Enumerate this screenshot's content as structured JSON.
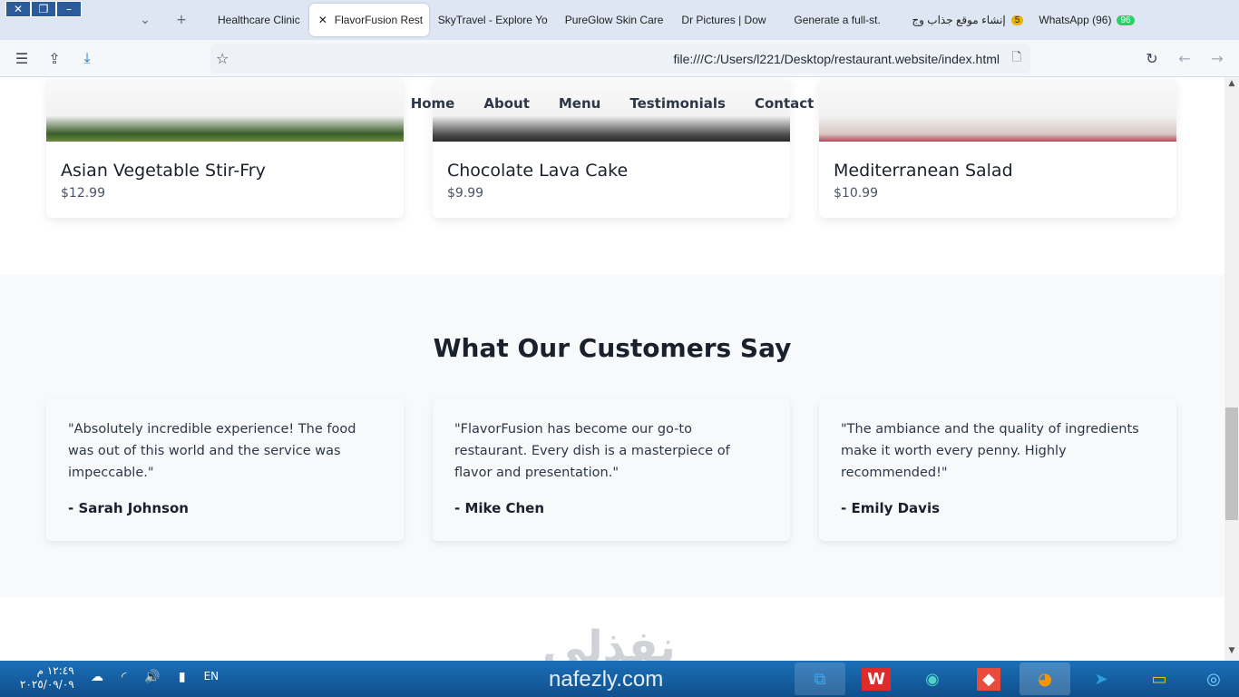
{
  "browser": {
    "tabs": [
      {
        "title": "Healthcare Clinic",
        "active": false
      },
      {
        "title": "FlavorFusion Rest",
        "active": true
      },
      {
        "title": "SkyTravel - Explore Yo",
        "active": false
      },
      {
        "title": "PureGlow Skin Care",
        "active": false
      },
      {
        "title": "Dr Pictures | Dow",
        "active": false
      },
      {
        "title": "Generate a full-st.",
        "active": false
      },
      {
        "title": "إنشاء موقع جذاب وج",
        "active": false,
        "badge": "5"
      },
      {
        "title": "WhatsApp (96)",
        "active": false,
        "badge": "96"
      }
    ],
    "url": "file:///C:/Users/l221/Desktop/restaurant.website/index.html"
  },
  "nav": {
    "items": [
      "Home",
      "About",
      "Menu",
      "Testimonials",
      "Contact"
    ]
  },
  "menu": {
    "items": [
      {
        "name": "Asian Vegetable Stir-Fry",
        "price": "$12.99"
      },
      {
        "name": "Chocolate Lava Cake",
        "price": "$9.99"
      },
      {
        "name": "Mediterranean Salad",
        "price": "$10.99"
      }
    ]
  },
  "testimonials": {
    "title": "What Our Customers Say",
    "items": [
      {
        "quote": "\"Absolutely incredible experience! The food was out of this world and the service was impeccable.\"",
        "author": "- Sarah Johnson"
      },
      {
        "quote": "\"FlavorFusion has become our go-to restaurant. Every dish is a masterpiece of flavor and presentation.\"",
        "author": "- Mike Chen"
      },
      {
        "quote": "\"The ambiance and the quality of ingredients make it worth every penny. Highly recommended!\"",
        "author": "- Emily Davis"
      }
    ]
  },
  "watermark": {
    "arabic": "نفذلي",
    "latin": "nafezly.com"
  },
  "taskbar": {
    "time": "١٢:٤٩ م",
    "date": "٢٠٢٥/٠٩/٠٩",
    "lang": "EN"
  },
  "colors": {
    "heading": "#1a202c",
    "text": "#2d3748",
    "section_bg": "#f7f9fb"
  }
}
